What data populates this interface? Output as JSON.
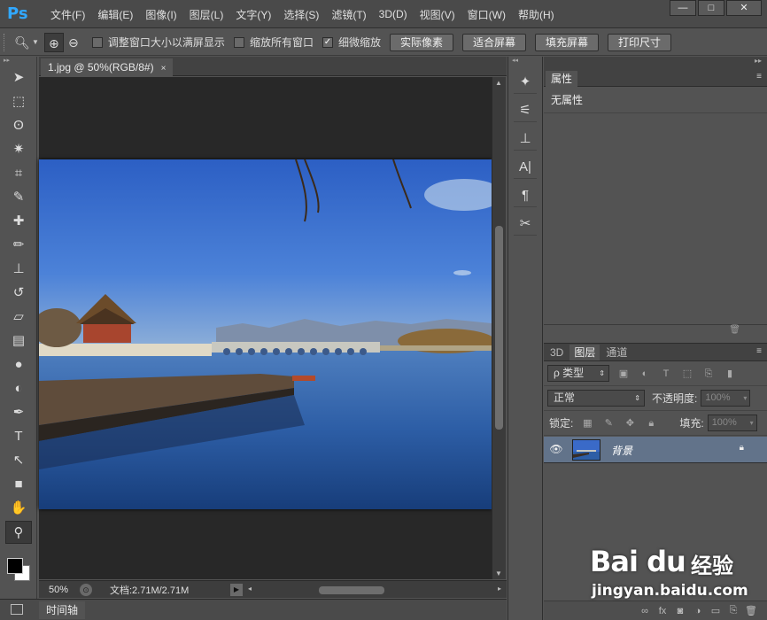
{
  "app": {
    "logo": "Ps"
  },
  "menu": [
    "文件(F)",
    "编辑(E)",
    "图像(I)",
    "图层(L)",
    "文字(Y)",
    "选择(S)",
    "滤镜(T)",
    "3D(D)",
    "视图(V)",
    "窗口(W)",
    "帮助(H)"
  ],
  "window_controls": {
    "minimize": "—",
    "maximize": "□",
    "close": "✕"
  },
  "options": {
    "resize_windows": "调整窗口大小以满屏显示",
    "zoom_all": "缩放所有窗口",
    "scrubby_zoom": "细微缩放",
    "scrubby_checked": true,
    "actual_pixels": "实际像素",
    "fit_screen": "适合屏幕",
    "fill_screen": "填充屏幕",
    "print_size": "打印尺寸"
  },
  "document": {
    "tab_title": "1.jpg @ 50%(RGB/8#)",
    "close": "×"
  },
  "status": {
    "zoom": "50%",
    "doc_size": "文档:2.71M/2.71M"
  },
  "timeline": {
    "label": "时间轴"
  },
  "properties": {
    "tab": "属性",
    "content": "无属性"
  },
  "layers": {
    "tabs": [
      "3D",
      "图层",
      "通道"
    ],
    "active_tab": "图层",
    "filter_kind": "ρ 类型",
    "blend_mode": "正常",
    "opacity_label": "不透明度:",
    "opacity_value": "100%",
    "lock_label": "锁定:",
    "fill_label": "填充:",
    "fill_value": "100%",
    "items": [
      {
        "name": "背景",
        "visible": true,
        "locked": true
      }
    ]
  },
  "watermark": {
    "logo": "Bai du",
    "brand_cn": "经验",
    "url": "jingyan.baidu.com"
  },
  "colors": {
    "foreground": "#000000",
    "background": "#ffffff",
    "accent": "#31a8ff",
    "selected_layer": "#62738a"
  }
}
